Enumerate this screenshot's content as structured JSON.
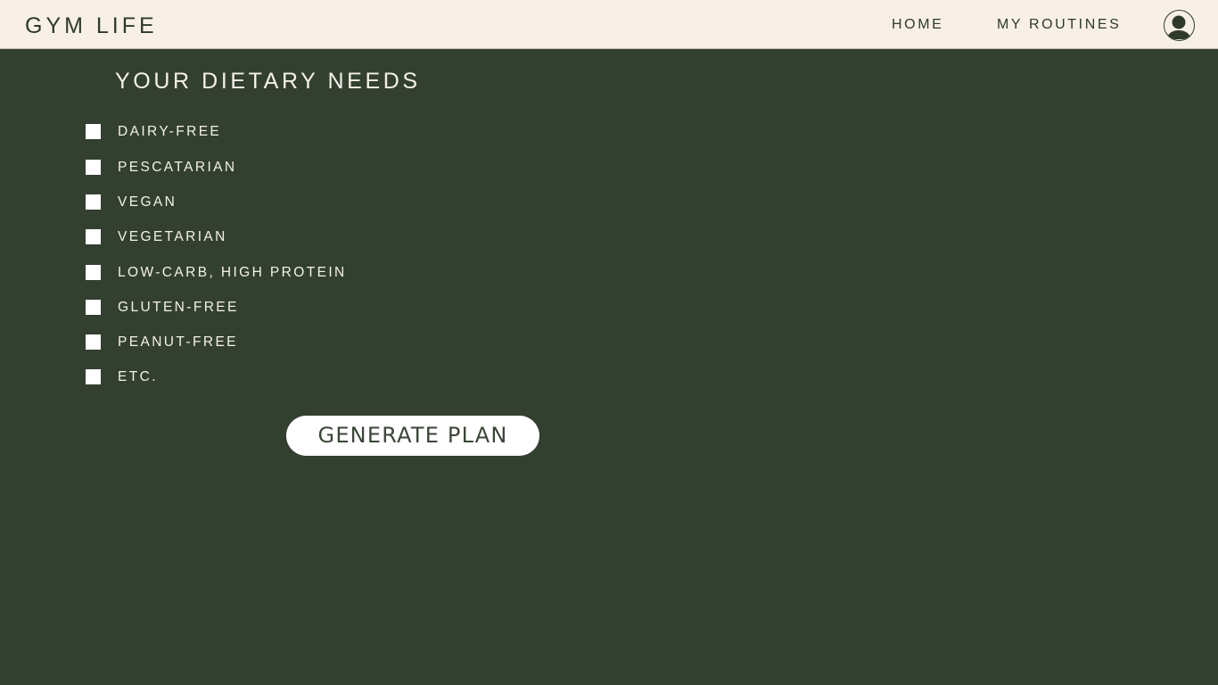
{
  "header": {
    "brand": "GYM LIFE",
    "nav": {
      "home": "HOME",
      "my_routines": "MY ROUTINES"
    },
    "avatar_icon": "user-avatar-icon"
  },
  "main": {
    "title": "YOUR DIETARY NEEDS",
    "options": [
      {
        "label": "DAIRY-FREE",
        "checked": false
      },
      {
        "label": "PESCATARIAN",
        "checked": false
      },
      {
        "label": "VEGAN",
        "checked": false
      },
      {
        "label": "VEGETARIAN",
        "checked": false
      },
      {
        "label": "LOW-CARB, HIGH PROTEIN",
        "checked": false
      },
      {
        "label": "GLUTEN-FREE",
        "checked": false
      },
      {
        "label": "PEANUT-FREE",
        "checked": false
      },
      {
        "label": "ETC.",
        "checked": false
      }
    ],
    "generate_label": "GENERATE PLAN"
  },
  "colors": {
    "background": "#334030",
    "header_background": "#f8f0e6",
    "header_text": "#2e3a2c",
    "body_text": "#f4f1ea",
    "button_background": "#ffffff"
  }
}
